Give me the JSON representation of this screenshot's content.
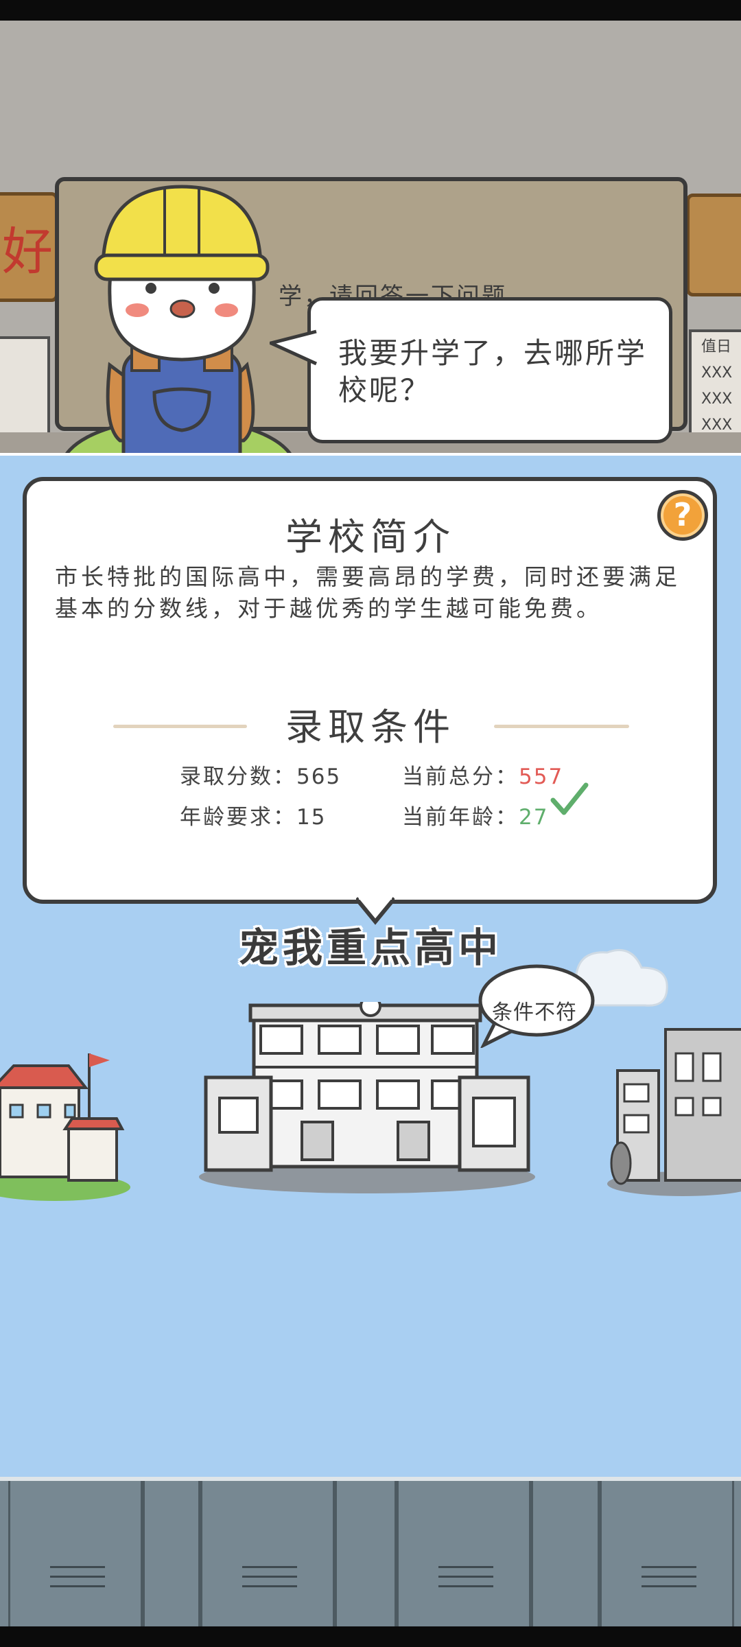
{
  "scene": {
    "sign_left_char": "好",
    "chalkboard_text": "学，请回答一下问题",
    "duty_chart_title": "值日",
    "duty_chart_rows": [
      "XXX",
      "XXX",
      "XXX"
    ]
  },
  "dialog": {
    "text": "我要升学了，去哪所学校呢？"
  },
  "help_button": {
    "label": "?"
  },
  "intro": {
    "title": "学校简介",
    "text": "市长特批的国际高中，需要高昂的学费，同时还要满足基本的分数线，对于越优秀的学生越可能免费。"
  },
  "requirements": {
    "title": "录取条件",
    "score_label": "录取分数：",
    "score_value": "565",
    "age_label": "年龄要求：",
    "age_value": "15",
    "current_score_label": "当前总分：",
    "current_score_value": "557",
    "current_age_label": "当前年龄：",
    "current_age_value": "27",
    "fail_color": "#e25a55",
    "pass_color": "#5fae6c"
  },
  "school": {
    "name": "宠我重点高中",
    "status": "条件不符"
  },
  "colors": {
    "sky": "#a9cff2",
    "wall": "#b1aea9",
    "accent": "#f2a23a",
    "locker": "#778892"
  }
}
